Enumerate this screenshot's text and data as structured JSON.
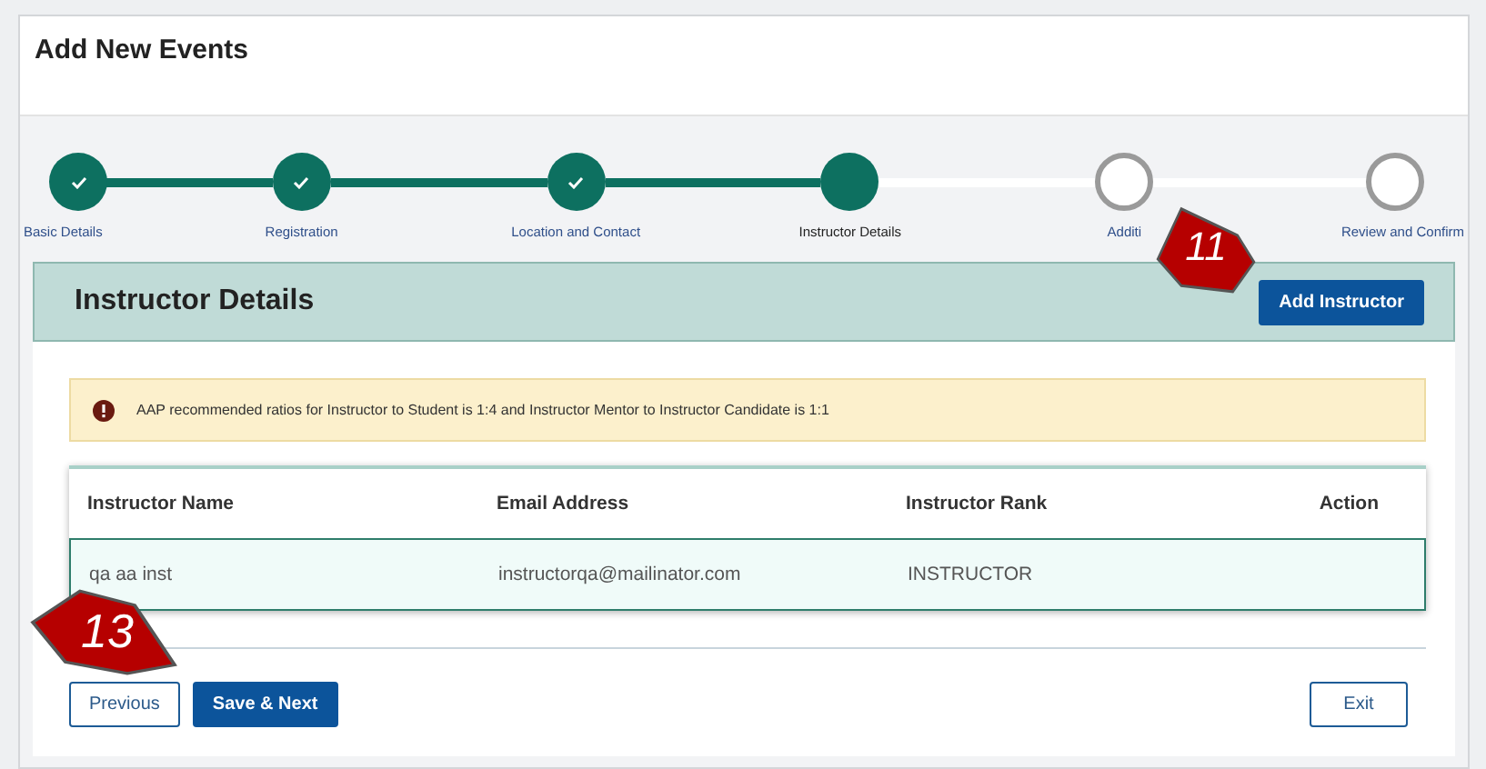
{
  "window": {
    "title": "Add New Events"
  },
  "steps": [
    {
      "label": "Basic Details",
      "completed": true,
      "selected": false
    },
    {
      "label": "Registration",
      "completed": true,
      "selected": false
    },
    {
      "label": "Location and Contact",
      "completed": true,
      "selected": false
    },
    {
      "label": "Instructor Details",
      "completed": false,
      "selected": true
    },
    {
      "label": "Additi",
      "completed": false,
      "selected": false
    },
    {
      "label": "Review and Confirm",
      "completed": false,
      "selected": false
    }
  ],
  "section": {
    "title": "Instructor Details",
    "button": "Add Instructor"
  },
  "alert": {
    "text": "AAP recommended ratios for Instructor to Student is 1:4 and Instructor Mentor to Instructor Candidate is 1:1"
  },
  "table": {
    "columns": [
      "Instructor Name",
      "Email Address",
      "Instructor Rank",
      "Action"
    ],
    "rows": [
      {
        "cells": [
          "qa aa inst",
          "instructorqa@mailinator.com",
          "INSTRUCTOR"
        ],
        "selected": true
      }
    ]
  },
  "buttons": [
    {
      "label": "Previous",
      "kind": "outline"
    },
    {
      "label": "Save & Next",
      "kind": "primary"
    },
    {
      "label": "Exit",
      "kind": "outline"
    }
  ],
  "callouts": [
    {
      "label": "11"
    },
    {
      "label": "13"
    }
  ]
}
